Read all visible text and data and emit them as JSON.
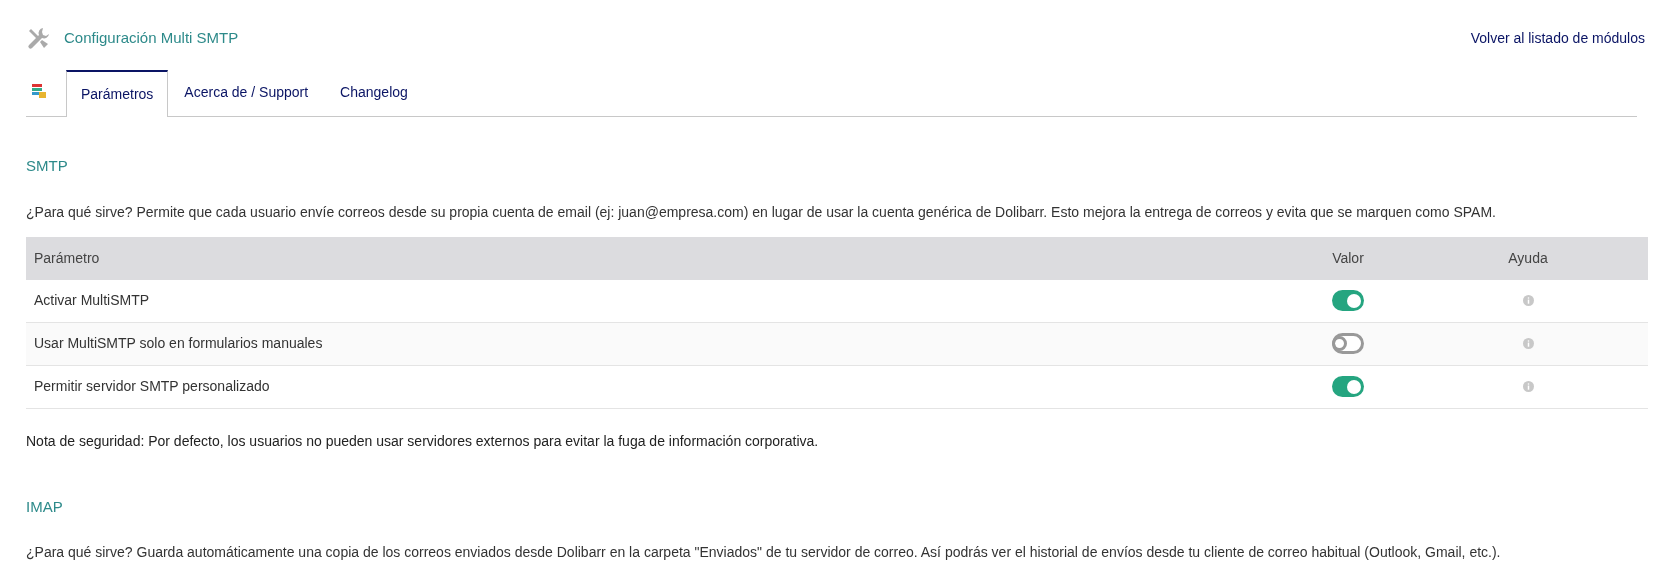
{
  "header": {
    "title": "Configuración Multi SMTP",
    "back_link": "Volver al listado de módulos"
  },
  "tabs": [
    {
      "label": "Parámetros",
      "selected": true
    },
    {
      "label": "Acerca de / Support",
      "selected": false
    },
    {
      "label": "Changelog",
      "selected": false
    }
  ],
  "sections": [
    {
      "heading": "SMTP",
      "description": "¿Para qué sirve? Permite que cada usuario envíe correos desde su propia cuenta de email (ej: juan@empresa.com) en lugar de usar la cuenta genérica de Dolibarr. Esto mejora la entrega de correos y evita que se marquen como SPAM.",
      "table": {
        "columns": [
          "Parámetro",
          "Valor",
          "Ayuda"
        ],
        "rows": [
          {
            "label": "Activar MultiSMTP",
            "on": true
          },
          {
            "label": "Usar MultiSMTP solo en formularios manuales",
            "on": false
          },
          {
            "label": "Permitir servidor SMTP personalizado",
            "on": true
          }
        ]
      },
      "note": "Nota de seguridad: Por defecto, los usuarios no pueden usar servidores externos para evitar la fuga de información corporativa."
    },
    {
      "heading": "IMAP",
      "description": "¿Para qué sirve? Guarda automáticamente una copia de los correos enviados desde Dolibarr en la carpeta \"Enviados\" de tu servidor de correo. Así podrás ver el historial de envíos desde tu cliente de correo habitual (Outlook, Gmail, etc.)."
    }
  ]
}
